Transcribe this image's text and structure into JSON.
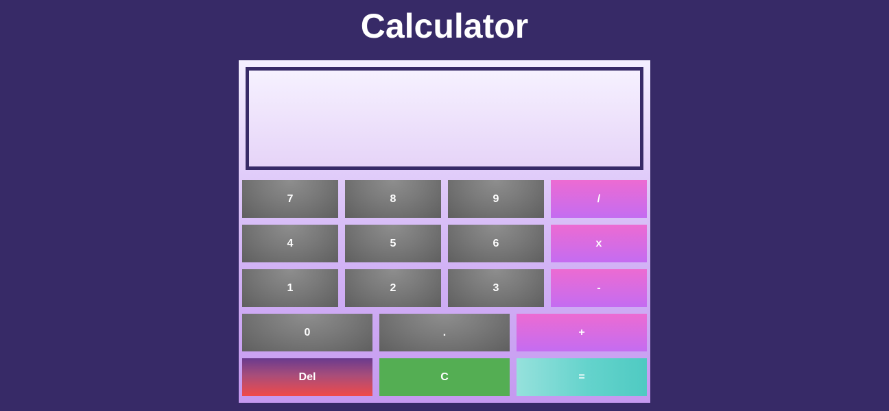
{
  "page": {
    "title": "Calculator"
  },
  "display": {
    "value": ""
  },
  "keys": {
    "seven": "7",
    "eight": "8",
    "nine": "9",
    "divide": "/",
    "four": "4",
    "five": "5",
    "six": "6",
    "multiply": "x",
    "one": "1",
    "two": "2",
    "three": "3",
    "subtract": "-",
    "zero": "0",
    "decimal": ".",
    "add": "+",
    "delete": "Del",
    "clear": "C",
    "equals": "="
  },
  "colors": {
    "background": "#372a67",
    "number_key": "#7a7a7a",
    "operator_key_top": "#ec6bd2",
    "operator_key_bottom": "#c46cf1",
    "clear_key": "#54ae53",
    "equals_key": "#64d3cc",
    "delete_key_bottom": "#f04a4a"
  }
}
